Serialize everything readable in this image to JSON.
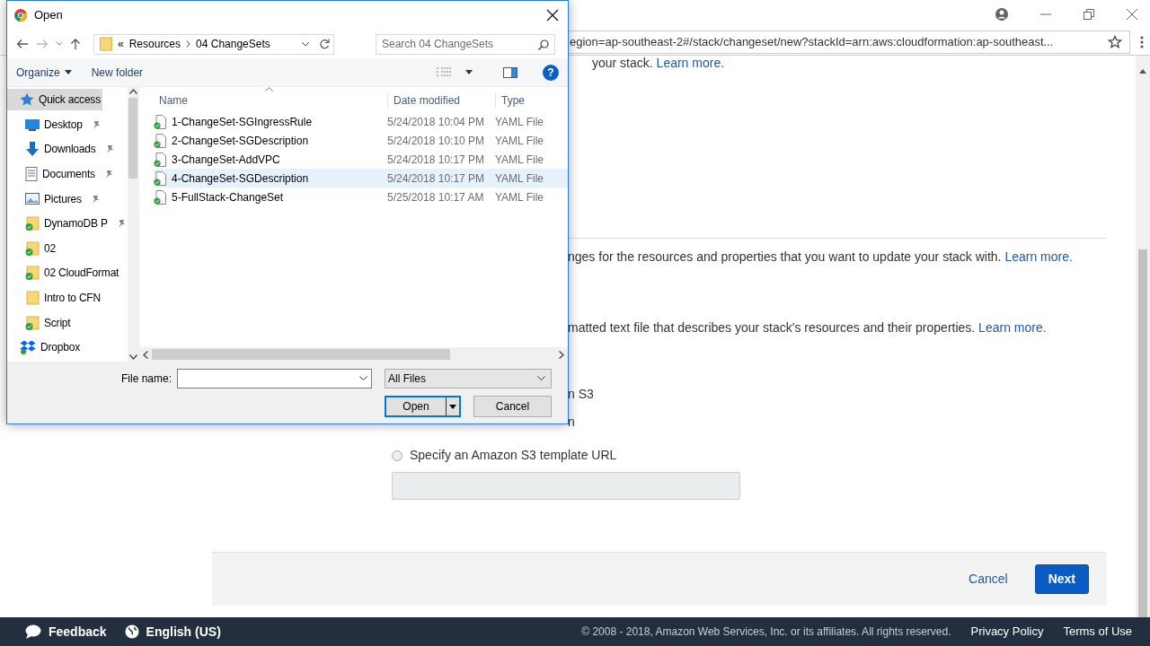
{
  "browser": {
    "url": "egion=ap-southeast-2#/stack/changeset/new?stackId=arn:aws:cloudformation:ap-southeast..."
  },
  "page": {
    "paragraphs": [
      {
        "text": "your stack.",
        "link": "Learn more."
      },
      {
        "text": "nges for the resources and properties that you want to update your stack with.",
        "link": "Learn more."
      },
      {
        "text": "matted text file that describes your stack's resources and their properties.",
        "link": "Learn more."
      }
    ],
    "option_fragments": [
      "n S3",
      "n"
    ],
    "url_option": {
      "label": "Specify an Amazon S3 template URL",
      "selected": false
    },
    "actions": {
      "cancel": "Cancel",
      "next": "Next"
    }
  },
  "footer": {
    "feedback": "Feedback",
    "language": "English (US)",
    "copyright": "© 2008 - 2018, Amazon Web Services, Inc. or its affiliates. All rights reserved.",
    "links": [
      "Privacy Policy",
      "Terms of Use"
    ]
  },
  "dialog": {
    "title": "Open",
    "breadcrumb": {
      "overflow": "«",
      "segments": [
        "Resources",
        "04 ChangeSets"
      ]
    },
    "search": {
      "placeholder": "Search 04 ChangeSets"
    },
    "toolbar": {
      "organize": "Organize",
      "new_folder": "New folder",
      "help": "?"
    },
    "sidebar": {
      "items": [
        {
          "label": "Quick access",
          "kind": "star",
          "selected": true,
          "children": [
            {
              "label": "Desktop",
              "kind": "desktop",
              "pinned": true,
              "selected": false
            },
            {
              "label": "Downloads",
              "kind": "download",
              "pinned": true,
              "selected": false
            },
            {
              "label": "Documents",
              "kind": "documents",
              "pinned": true,
              "selected": false
            },
            {
              "label": "Pictures",
              "kind": "pictures",
              "pinned": true,
              "selected": false
            },
            {
              "label": "DynamoDB P",
              "kind": "synced",
              "pinned": true,
              "selected": false
            },
            {
              "label": "02",
              "kind": "synced",
              "pinned": false,
              "selected": false
            },
            {
              "label": "02 CloudFormat",
              "kind": "synced",
              "pinned": false,
              "selected": false
            },
            {
              "label": "Intro to CFN",
              "kind": "folder",
              "pinned": false,
              "selected": false
            },
            {
              "label": "Script",
              "kind": "synced",
              "pinned": false,
              "selected": false
            }
          ]
        },
        {
          "label": "Dropbox",
          "kind": "dropbox",
          "selected": false
        }
      ]
    },
    "files": {
      "columns": [
        "Name",
        "Date modified",
        "Type"
      ],
      "rows": [
        {
          "name": "1-ChangeSet-SGIngressRule",
          "date": "5/24/2018 10:04 PM",
          "type": "YAML File",
          "selected": false
        },
        {
          "name": "2-ChangeSet-SGDescription",
          "date": "5/24/2018 10:10 PM",
          "type": "YAML File",
          "selected": false
        },
        {
          "name": "3-ChangeSet-AddVPC",
          "date": "5/24/2018 10:17 PM",
          "type": "YAML File",
          "selected": false
        },
        {
          "name": "4-ChangeSet-SGDescription",
          "date": "5/24/2018 10:17 PM",
          "type": "YAML File",
          "selected": true
        },
        {
          "name": "5-FullStack-ChangeSet",
          "date": "5/25/2018 10:17 AM",
          "type": "YAML File",
          "selected": false
        }
      ]
    },
    "file_name_label": "File name:",
    "filter": "All Files",
    "buttons": {
      "open": "Open",
      "cancel": "Cancel"
    }
  }
}
